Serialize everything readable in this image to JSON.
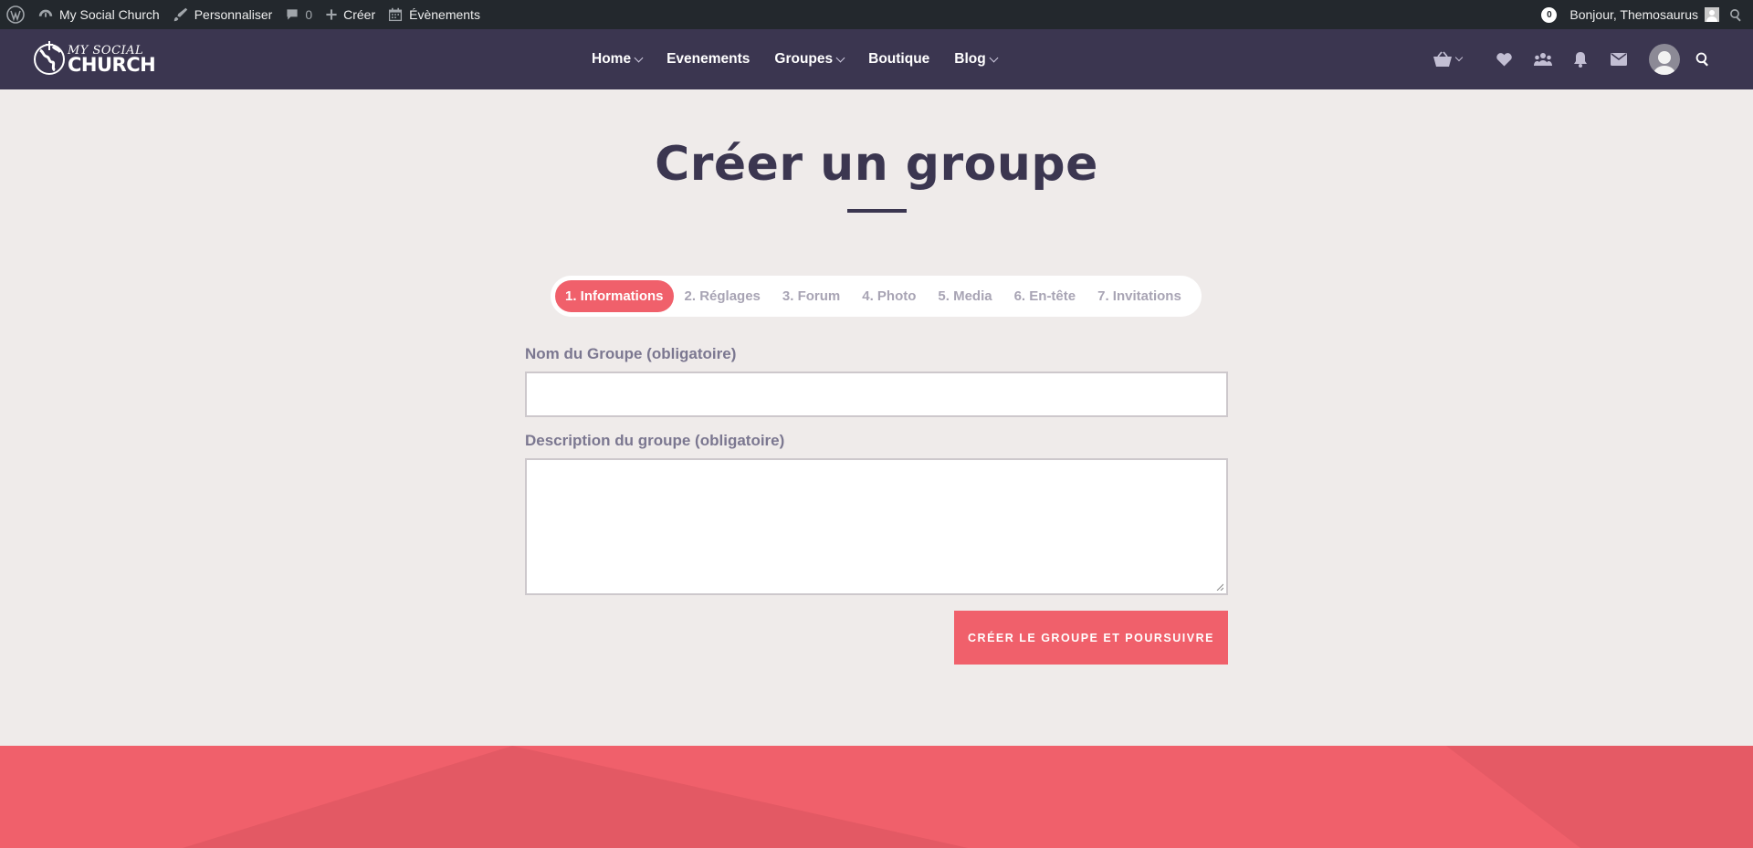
{
  "adminbar": {
    "site_name": "My Social Church",
    "customize_label": "Personnaliser",
    "comments_count": "0",
    "new_label": "Créer",
    "events_label": "Évènements",
    "notif_count": "0",
    "greeting": "Bonjour, Themosaurus"
  },
  "brand": {
    "logo_top": "MY SOCIAL",
    "logo_bottom": "CHURCH"
  },
  "nav": {
    "items": [
      {
        "label": "Home"
      },
      {
        "label": "Evenements"
      },
      {
        "label": "Groupes"
      },
      {
        "label": "Boutique"
      },
      {
        "label": "Blog"
      }
    ]
  },
  "page": {
    "title": "Créer un groupe"
  },
  "steps": [
    {
      "label": "1. Informations"
    },
    {
      "label": "2. Réglages"
    },
    {
      "label": "3. Forum"
    },
    {
      "label": "4. Photo"
    },
    {
      "label": "5. Media"
    },
    {
      "label": "6. En-tête"
    },
    {
      "label": "7. Invitations"
    }
  ],
  "form": {
    "name_label": "Nom du Groupe (obligatoire)",
    "name_value": "",
    "description_label": "Description du groupe (obligatoire)",
    "description_value": "",
    "submit_label": "CRÉER LE GROUPE ET POURSUIVRE"
  },
  "colors": {
    "accent": "#f0606b",
    "nav_bg": "#3b3650",
    "admin_bg": "#23282d",
    "page_bg": "#efebea"
  }
}
